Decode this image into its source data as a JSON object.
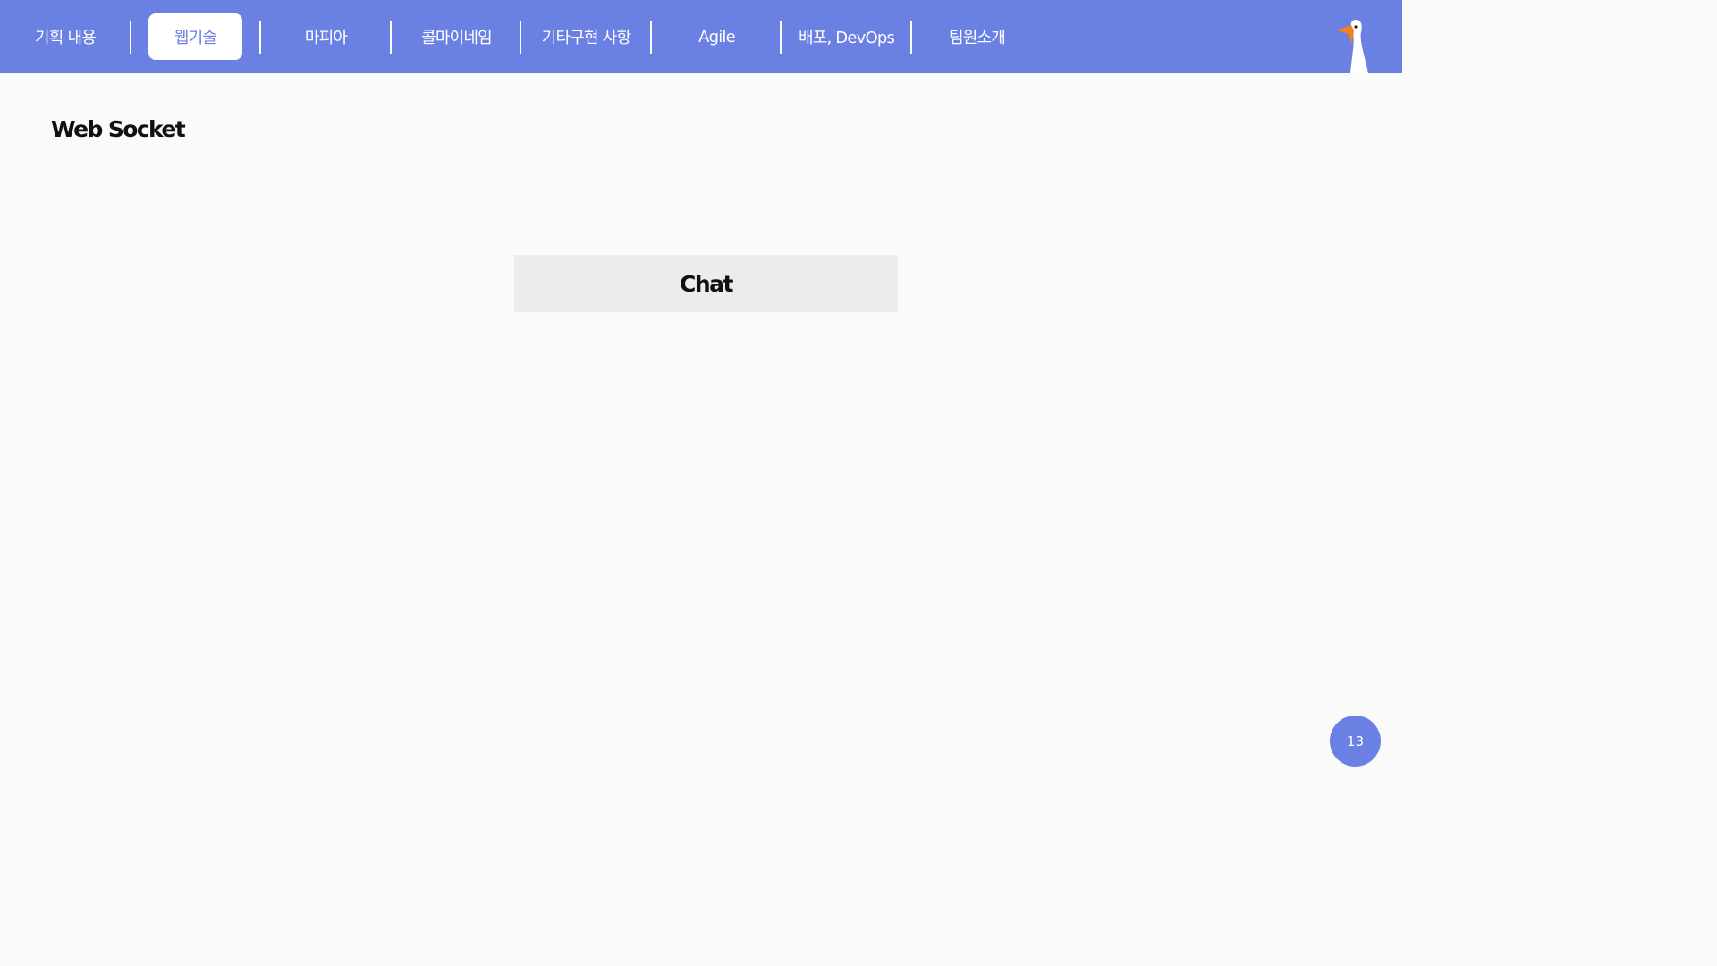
{
  "nav": {
    "items": [
      {
        "label": "기획 내용",
        "active": false
      },
      {
        "label": "웹기술",
        "active": true
      },
      {
        "label": "마피아",
        "active": false
      },
      {
        "label": "콜마이네임",
        "active": false
      },
      {
        "label": "기타구현 사항",
        "active": false
      },
      {
        "label": "Agile",
        "active": false
      },
      {
        "label": "배포, DevOps",
        "active": false
      },
      {
        "label": "팀원소개",
        "active": false
      }
    ],
    "logo_icon": "goose-icon"
  },
  "main": {
    "title": "Web Socket",
    "chat_button_label": "Chat"
  },
  "footer": {
    "page_number": "13"
  },
  "colors": {
    "accent": "#6a80e2",
    "background": "#fafaf9",
    "button_bg": "#ececea",
    "goose_beak": "#f08020"
  }
}
